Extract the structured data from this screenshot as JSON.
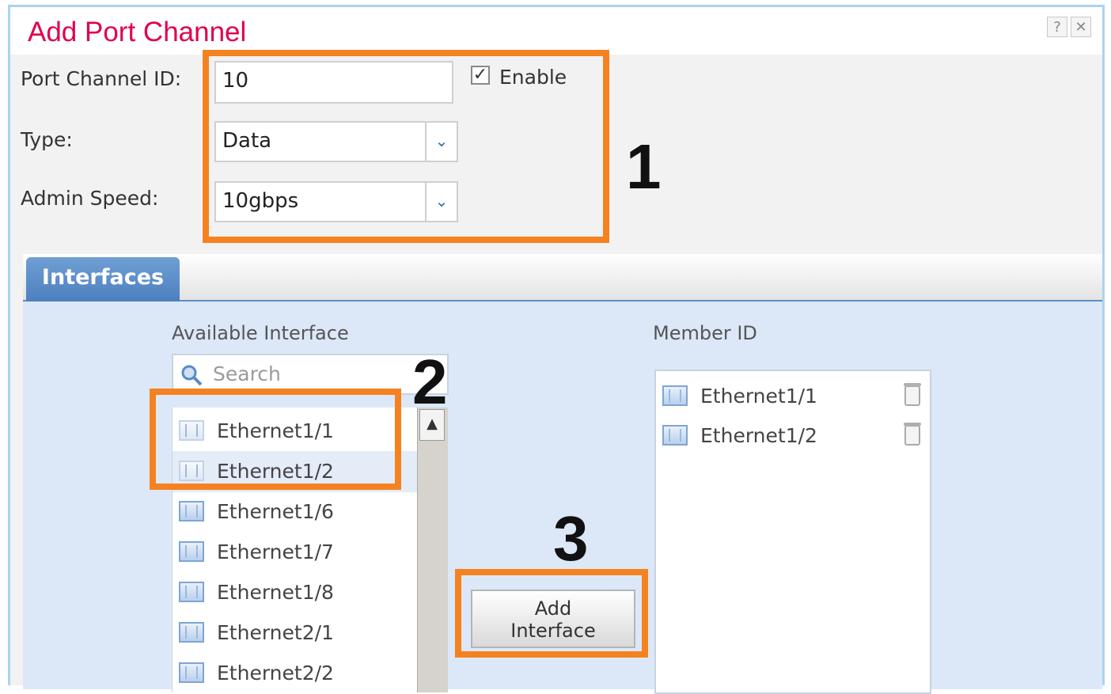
{
  "dialog": {
    "title": "Add Port Channel",
    "help_glyph": "?",
    "close_glyph": "✕"
  },
  "form": {
    "port_channel_id_label": "Port Channel ID:",
    "port_channel_id_value": "10",
    "enable_label": "Enable",
    "enable_checked": true,
    "type_label": "Type:",
    "type_value": "Data",
    "admin_speed_label": "Admin Speed:",
    "admin_speed_value": "10gbps"
  },
  "tabs": [
    {
      "label": "Interfaces",
      "active": true
    }
  ],
  "available": {
    "title": "Available Interface",
    "search_placeholder": "Search",
    "items": [
      {
        "label": "Ethernet1/1",
        "selected": false,
        "faded": true
      },
      {
        "label": "Ethernet1/2",
        "selected": true,
        "faded": true
      },
      {
        "label": "Ethernet1/6",
        "selected": false,
        "faded": false
      },
      {
        "label": "Ethernet1/7",
        "selected": false,
        "faded": false
      },
      {
        "label": "Ethernet1/8",
        "selected": false,
        "faded": false
      },
      {
        "label": "Ethernet2/1",
        "selected": false,
        "faded": false
      },
      {
        "label": "Ethernet2/2",
        "selected": false,
        "faded": false
      }
    ]
  },
  "add_button": {
    "line1": "Add",
    "line2": "Interface"
  },
  "members": {
    "title": "Member ID",
    "items": [
      {
        "label": "Ethernet1/1"
      },
      {
        "label": "Ethernet1/2"
      }
    ]
  },
  "annotations": {
    "step1": "1",
    "step2": "2",
    "step3": "3",
    "highlight_color": "#f58220"
  },
  "colors": {
    "title": "#e0004d",
    "tab": "#5b8ec7",
    "panel": "#dce8f8"
  }
}
